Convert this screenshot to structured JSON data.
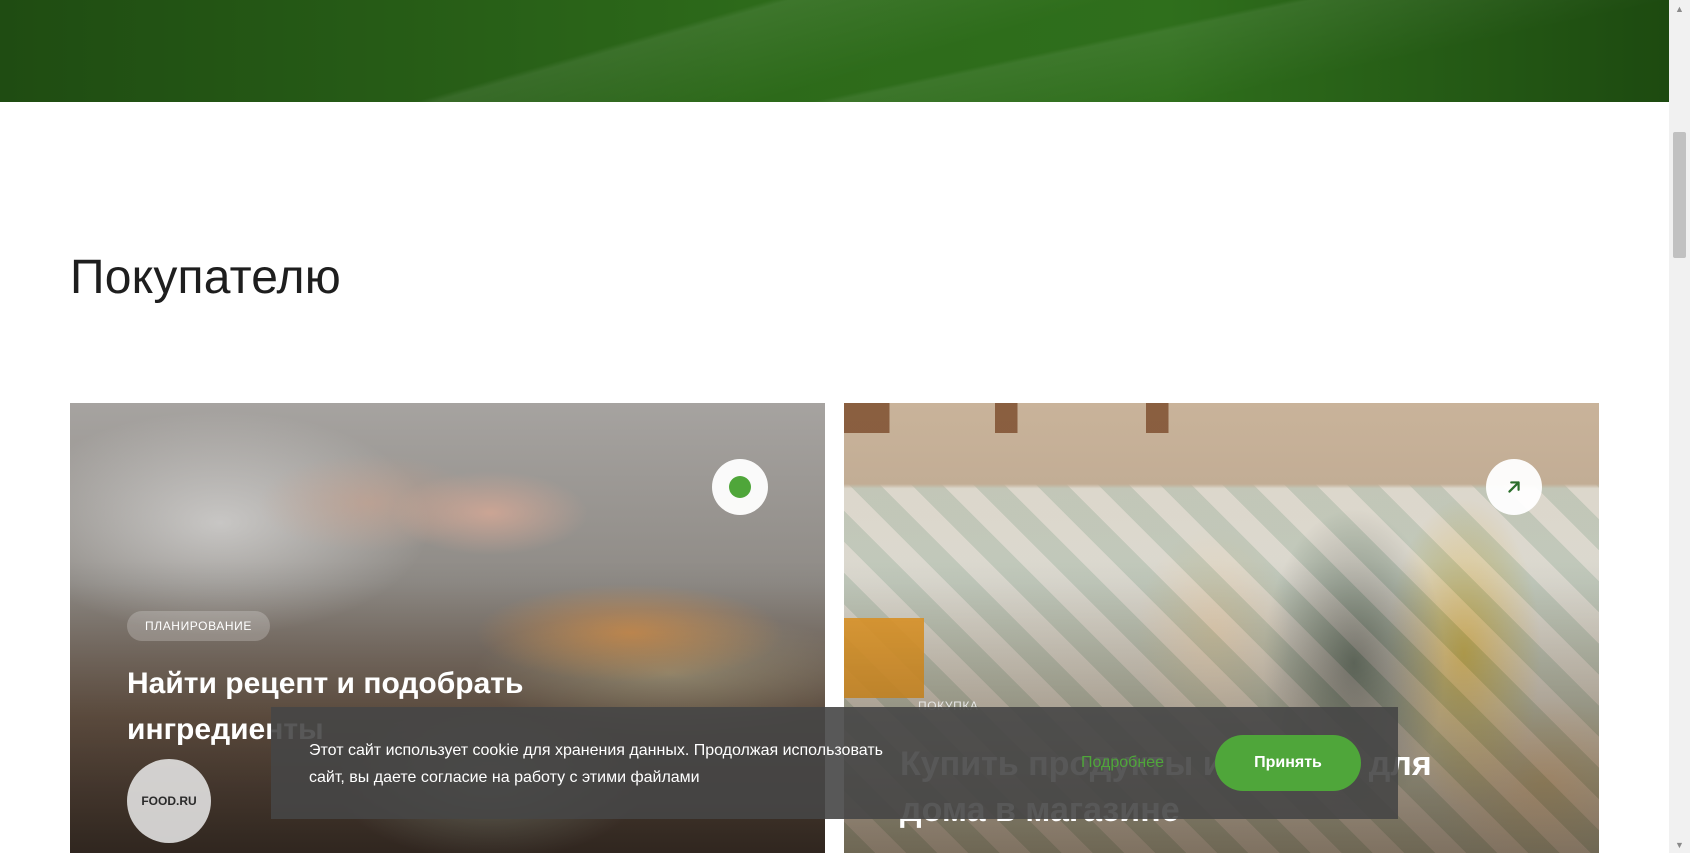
{
  "section": {
    "title": "Покупателю"
  },
  "cards": [
    {
      "tag": "Планирование",
      "title": "Найти рецепт и подобрать ингредиенты",
      "source": "FOOD.RU",
      "badge_icon": "green-dot-icon"
    },
    {
      "tag": "Покупка",
      "title": "Купить продукты и товары для дома в магазине",
      "badge_icon": "arrow-up-right-icon"
    }
  ],
  "cookie": {
    "text": "Этот сайт использует cookie для хранения данных. Продолжая использовать сайт, вы даете согласие на работу с этими файлами",
    "more_label": "Подробнее",
    "accept_label": "Принять"
  },
  "scrollbar": {
    "up_icon": "▲",
    "down_icon": "▼"
  },
  "colors": {
    "accent": "#4fa63a",
    "banner": "#2d6a1a"
  }
}
